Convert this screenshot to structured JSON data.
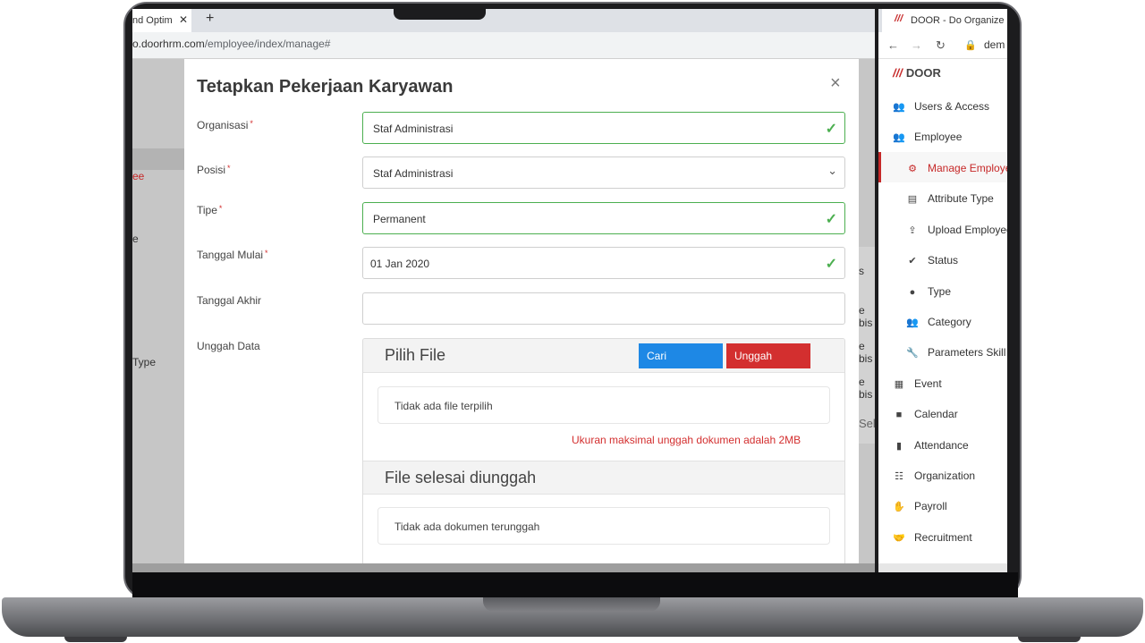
{
  "left_browser": {
    "tab_title": "nd Optim",
    "tab_close": "✕",
    "new_tab": "+",
    "url_host": "o.doorhrm.com",
    "url_path": "/employee/index/manage#",
    "ghost_texts": [
      "ee",
      "e",
      "Type"
    ],
    "ghost_right_texts": [
      "s",
      "e bis",
      "e bis",
      "e bis",
      "Sel"
    ]
  },
  "modal": {
    "title": "Tetapkan Pekerjaan Karyawan",
    "close": "×",
    "required_mark": "*",
    "fields": [
      {
        "label": "Organisasi",
        "value": "Staf Administrasi"
      },
      {
        "label": "Posisi",
        "value": "Staf Administrasi"
      },
      {
        "label": "Tipe",
        "value": "Permanent"
      },
      {
        "label": "Tanggal Mulai",
        "value": "01 Jan 2020"
      },
      {
        "label": "Tanggal Akhir",
        "value": ""
      },
      {
        "label": "Unggah Data"
      }
    ],
    "upload": {
      "choose_title": "Pilih File",
      "btn_search": "Cari",
      "btn_upload": "Unggah",
      "no_file": "Tidak ada file terpilih",
      "limit_note": "Ukuran maksimal unggah dokumen adalah 2MB",
      "done_title": "File selesai diunggah",
      "no_docs": "Tidak ada dokumen terunggah"
    }
  },
  "right_browser": {
    "tab_title": "DOOR - Do Organize and",
    "url_text": "dem",
    "logo": "DOOR",
    "nav": [
      {
        "label": "Users & Access",
        "icon": "users-icon"
      },
      {
        "label": "Employee",
        "icon": "users-icon"
      },
      {
        "label": "Manage Employee",
        "icon": "users-cog-icon",
        "active": true
      },
      {
        "label": "Attribute Type",
        "icon": "id-card-icon"
      },
      {
        "label": "Upload Employee",
        "icon": "upload-icon"
      },
      {
        "label": "Status",
        "icon": "user-check-icon"
      },
      {
        "label": "Type",
        "icon": "user-tag-icon"
      },
      {
        "label": "Category",
        "icon": "users-icon"
      },
      {
        "label": "Parameters Skill",
        "icon": "wrench-icon"
      },
      {
        "label": "Event",
        "icon": "calendar-check-icon"
      },
      {
        "label": "Calendar",
        "icon": "calendar-icon"
      },
      {
        "label": "Attendance",
        "icon": "door-icon"
      },
      {
        "label": "Organization",
        "icon": "sitemap-icon"
      },
      {
        "label": "Payroll",
        "icon": "hand-coin-icon"
      },
      {
        "label": "Recruitment",
        "icon": "handshake-icon"
      }
    ]
  },
  "colors": {
    "accent_red": "#c62828",
    "valid_green": "#4caf50",
    "button_blue": "#1e88e5",
    "button_red": "#d32f2f"
  }
}
